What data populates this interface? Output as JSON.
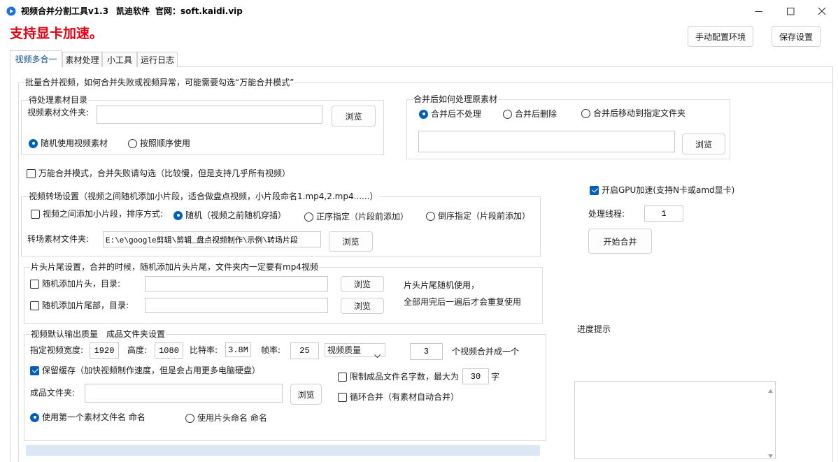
{
  "window": {
    "app_name": "视频合并分割工具v1.3",
    "company": "凯迪软件",
    "website": "官网：soft.kaidi.vip",
    "icons": {
      "app": "play-circle-icon",
      "minimize": "minimize-icon",
      "maximize": "maximize-icon",
      "close": "close-icon"
    }
  },
  "banner": {
    "text": "支持显卡加速。"
  },
  "toolbar": {
    "config_env_label": "手动配置环境",
    "save_settings_label": "保存设置"
  },
  "tabs": [
    {
      "label": "视频多合一",
      "selected": true
    },
    {
      "label": "素材处理",
      "selected": false
    },
    {
      "label": "小工具",
      "selected": false
    },
    {
      "label": "运行日志",
      "selected": false
    }
  ],
  "main_group": {
    "title": "批量合并视频，如何合并失败或视频异常，可能需要勾选“万能合并模式”"
  },
  "source": {
    "title": "待处理素材目录",
    "folder_label": "视频素材文件夹:",
    "browse_label": "浏览",
    "options": [
      {
        "label": "随机使用视频素材",
        "checked": true
      },
      {
        "label": "按照顺序使用",
        "checked": false
      }
    ]
  },
  "after_merge": {
    "title": "合并后如何处理原素材",
    "options": [
      {
        "label": "合并后不处理",
        "checked": true
      },
      {
        "label": "合并后删除",
        "checked": false
      },
      {
        "label": "合并后移动到指定文件夹",
        "checked": false
      }
    ],
    "browse_label": "浏览"
  },
  "universal_mode": {
    "label": "万能合并模式，合并失败请勾选（比较慢，但是支持几乎所有视频）",
    "checked": false
  },
  "transition": {
    "title": "视频转场设置（视频之间随机添加小片段，适合做盘点视频，小片段命名1.mp4,2.mp4......）",
    "enable": {
      "label": "视频之间添加小片段，排序方式:",
      "checked": false
    },
    "options": [
      {
        "label": "随机（视频之前随机穿插）",
        "checked": true
      },
      {
        "label": "正序指定（片段前添加）",
        "checked": false
      },
      {
        "label": "倒序指定（片段前添加）",
        "checked": false
      }
    ],
    "folder_label": "转场素材文件夹:",
    "folder_value": "E:\\e\\google剪辑\\剪辑_盘点视频制作\\示例\\转场片段",
    "browse_label": "浏览"
  },
  "intro_outro": {
    "title": "片头片尾设置，合并的时候，随机添加片头片尾，文件夹内一定要有mp4视频",
    "intro": {
      "label": "随机添加片头，目录:",
      "checked": false
    },
    "outro": {
      "label": "随机添加片尾部，目录:",
      "checked": false
    },
    "browse_label": "浏览",
    "note_line1": "片头片尾随机使用，",
    "note_line2": "全部用完后一遍后才会重复使用"
  },
  "output": {
    "title": "视频默认输出质量　成品文件夹设置",
    "width_label": "指定视频宽度:",
    "width": "1920",
    "height_label": "高度:",
    "height": "1080",
    "bitrate_label": "比特率:",
    "bitrate": "3.8M",
    "fps_label": "帧率:",
    "fps": "25",
    "quality_select": "视频质量",
    "merge_count": "3",
    "merge_count_suffix": "个视频合并成一个",
    "keep_cache": {
      "label": "保留缓存（加快视频制作速度，但是会占用更多电脑硬盘）",
      "checked": true
    },
    "limit_name": {
      "label": "限制成品文件名字数，最大为",
      "checked": false
    },
    "limit_name_max": "30",
    "limit_name_suffix": "字",
    "folder_label": "成品文件夹:",
    "browse_label": "浏览",
    "loop_merge": {
      "label": "循环合并（有素材自动合并）",
      "checked": false
    },
    "naming": [
      {
        "label": "使用第一个素材文件名 命名",
        "checked": true
      },
      {
        "label": "使用片头命名 命名",
        "checked": false
      }
    ]
  },
  "gpu": {
    "label": "开启GPU加速(支持N卡或amd显卡)",
    "checked": true
  },
  "threads": {
    "label": "处理线程:",
    "value": "1"
  },
  "start_button": {
    "label": "开始合并"
  },
  "progress_hint": {
    "label": "进度提示"
  },
  "colors": {
    "accent": "#005fb8",
    "banner_red": "#e60012",
    "progress_track": "#dbe7f4"
  }
}
